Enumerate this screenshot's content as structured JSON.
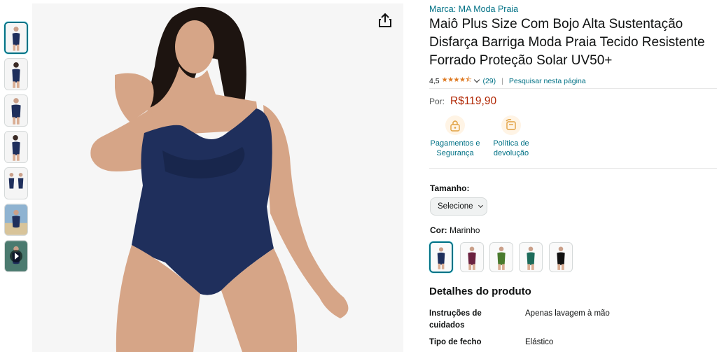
{
  "product": {
    "brand": "Marca: MA Moda Praia",
    "title": "Maiô Plus Size Com Bojo Alta Sustentação Disfarça Barriga Moda Praia Tecido Resistente Forrado Proteção Solar UV50+",
    "rating": "4,5",
    "stars": "★★★★⯪",
    "review_count": "(29)",
    "separator": "|",
    "search_page": "Pesquisar nesta página",
    "price_label": "Por:",
    "price": "R$119,90",
    "rating_value": 4.5
  },
  "features": [
    {
      "label": "Pagamentos e Segurança",
      "icon": "lock-icon"
    },
    {
      "label": "Política de devolução",
      "icon": "return-icon"
    }
  ],
  "size": {
    "label": "Tamanho:",
    "select_value": "Selecione"
  },
  "color": {
    "label": "Cor:",
    "value": "Marinho",
    "swatches": [
      "#1f2f5c",
      "#6b2240",
      "#4a7a2e",
      "#1d6b5a",
      "#111111"
    ]
  },
  "thumbnails": {
    "count": 7,
    "active_index": 0,
    "video_index": 6
  },
  "details": {
    "heading": "Detalhes do produto",
    "rows": [
      {
        "key": "Instruções de cuidados",
        "value": "Apenas lavagem à mão"
      },
      {
        "key": "Tipo de fecho",
        "value": "Elástico"
      }
    ]
  },
  "colors": {
    "link": "#007185",
    "price": "#b12704",
    "star": "#de7921",
    "swimsuit": "#1f2f5c"
  },
  "icons": {
    "share": "share-icon",
    "dropdown": "chevron-down-icon"
  }
}
